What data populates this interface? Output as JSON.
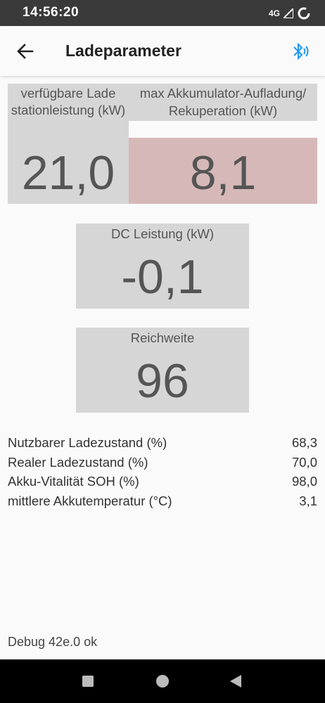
{
  "status_bar": {
    "time": "14:56:20",
    "network": "4G"
  },
  "toolbar": {
    "title": "Ladeparameter"
  },
  "tiles": {
    "station_power": {
      "label": "verfügbare Lade stationleistung (kW)",
      "value": "21,0"
    },
    "max_recuperation": {
      "label": "max Akkumulator-Aufladung/ Rekuperation (kW)",
      "value": "8,1"
    },
    "dc_power": {
      "label": "DC Leistung (kW)",
      "value": "-0,1"
    },
    "range": {
      "label": "Reichweite",
      "value": "96"
    }
  },
  "info_rows": [
    {
      "label": "Nutzbarer Ladezustand (%)",
      "value": "68,3"
    },
    {
      "label": "Realer Ladezustand (%)",
      "value": "70,0"
    },
    {
      "label": "Akku-Vitalität SOH (%)",
      "value": "98,0"
    },
    {
      "label": "mittlere Akkutemperatur (°C)",
      "value": "3,1"
    }
  ],
  "debug": "Debug 42e.0 ok",
  "colors": {
    "tile_grey": "#d6d6d6",
    "recuperation_red": "#d6b8b8",
    "bluetooth_blue": "#2196f3"
  },
  "icons": [
    "back-arrow-icon",
    "bluetooth-connected-icon",
    "signal-icon",
    "battery-icon",
    "square-icon",
    "circle-icon",
    "triangle-back-icon"
  ]
}
